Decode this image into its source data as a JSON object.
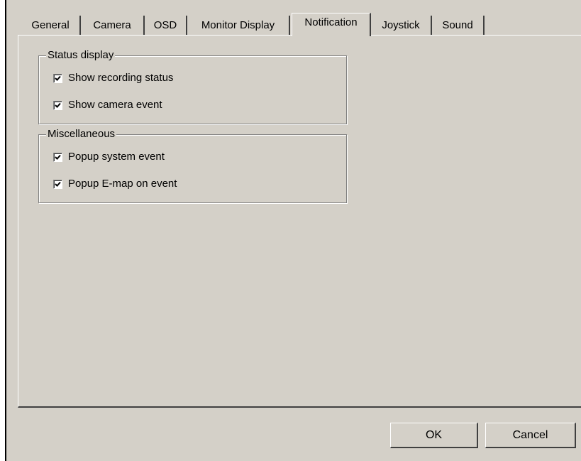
{
  "tabs": [
    {
      "label": "General"
    },
    {
      "label": "Camera"
    },
    {
      "label": "OSD"
    },
    {
      "label": "Monitor Display"
    },
    {
      "label": "Notification",
      "active": true
    },
    {
      "label": "Joystick"
    },
    {
      "label": "Sound"
    }
  ],
  "status_display": {
    "title": "Status display",
    "items": [
      {
        "label": "Show recording status",
        "checked": true
      },
      {
        "label": "Show camera event",
        "checked": true
      }
    ]
  },
  "miscellaneous": {
    "title": "Miscellaneous",
    "items": [
      {
        "label": "Popup system event",
        "checked": true
      },
      {
        "label": "Popup E-map on event",
        "checked": true
      }
    ]
  },
  "buttons": {
    "ok": "OK",
    "cancel": "Cancel"
  }
}
